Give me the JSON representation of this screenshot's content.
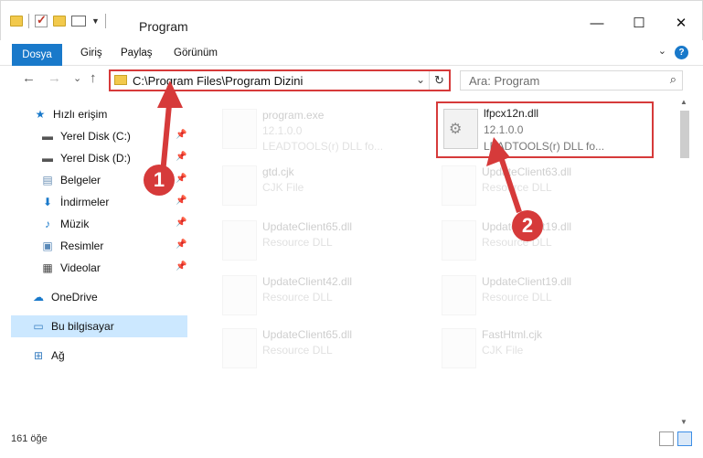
{
  "titlebar": {
    "title": "Program",
    "minimize": "—",
    "maximize": "☐",
    "close": "✕"
  },
  "ribbon": {
    "tabs": [
      "Dosya",
      "Giriş",
      "Paylaş",
      "Görünüm"
    ],
    "help": "?",
    "expand": "⌄"
  },
  "nav": {
    "back": "←",
    "forward": "→",
    "recent": "⌄",
    "up": "↑"
  },
  "address": {
    "path": "C:\\Program Files\\Program Dizini",
    "dropdown": "⌄",
    "refresh": "↻"
  },
  "search": {
    "placeholder": "Ara: Program",
    "icon": "⌕"
  },
  "sidebar": {
    "items": [
      {
        "label": "Hızlı erişim",
        "icon": "star-icon",
        "glyph": "★"
      },
      {
        "label": "Yerel Disk (C:)",
        "icon": "drive-icon",
        "glyph": "▬"
      },
      {
        "label": "Yerel Disk (D:)",
        "icon": "drive-icon",
        "glyph": "▬"
      },
      {
        "label": "Belgeler",
        "icon": "documents-icon",
        "glyph": "▤"
      },
      {
        "label": "İndirmeler",
        "icon": "download-icon",
        "glyph": "⬇"
      },
      {
        "label": "Müzik",
        "icon": "music-icon",
        "glyph": "♪"
      },
      {
        "label": "Resimler",
        "icon": "pictures-icon",
        "glyph": "▣"
      },
      {
        "label": "Videolar",
        "icon": "video-icon",
        "glyph": "▦"
      },
      {
        "label": "OneDrive",
        "icon": "cloud-icon",
        "glyph": "☁"
      },
      {
        "label": "Bu bilgisayar",
        "icon": "computer-icon",
        "glyph": "▭"
      },
      {
        "label": "Ağ",
        "icon": "network-icon",
        "glyph": "⊞"
      }
    ],
    "pin": "📌"
  },
  "files": [
    {
      "name": "program.exe",
      "sub1": "12.1.0.0",
      "sub2": "LEADTOOLS(r) DLL fo...",
      "faded": true
    },
    {
      "name": "lfpcx12n.dll",
      "sub1": "12.1.0.0",
      "sub2": "LEADTOOLS(r) DLL fo...",
      "faded": false
    },
    {
      "name": "gtd.cjk",
      "sub1": "CJK File",
      "sub2": "",
      "faded": true
    },
    {
      "name": "UpdateClient63.dll",
      "sub1": "Resource DLL",
      "sub2": "",
      "faded": true
    },
    {
      "name": "UpdateClient65.dll",
      "sub1": "Resource DLL",
      "sub2": "",
      "faded": true
    },
    {
      "name": "UpdateClient19.dll",
      "sub1": "Resource DLL",
      "sub2": "",
      "faded": true
    },
    {
      "name": "UpdateClient42.dll",
      "sub1": "Resource DLL",
      "sub2": "",
      "faded": true
    },
    {
      "name": "UpdateClient19.dll",
      "sub1": "Resource DLL",
      "sub2": "",
      "faded": true
    },
    {
      "name": "UpdateClient65.dll",
      "sub1": "Resource DLL",
      "sub2": "",
      "faded": true
    },
    {
      "name": "FastHtml.cjk",
      "sub1": "CJK File",
      "sub2": "",
      "faded": true
    }
  ],
  "status": {
    "count": "161 öğe"
  },
  "markers": [
    "1",
    "2"
  ],
  "colors": {
    "accent": "#1979ca",
    "highlight": "#d63a3a",
    "selected": "#cce8ff"
  }
}
